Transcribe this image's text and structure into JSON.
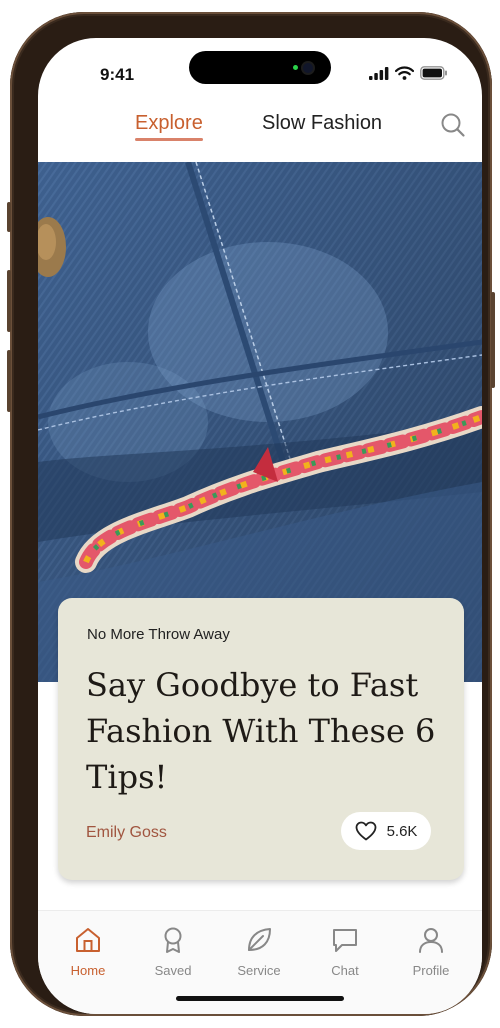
{
  "status_bar": {
    "time": "9:41"
  },
  "top_nav": {
    "tabs": [
      {
        "label": "Explore",
        "active": true
      },
      {
        "label": "Slow Fashion",
        "active": false
      }
    ]
  },
  "article": {
    "kicker": "No More Throw Away",
    "title": "Say Goodbye to Fast Fashion With These 6 Tips!",
    "author": "Emily Goss",
    "likes": "5.6K",
    "hero_image": "denim jacket with colorful embroidered hem"
  },
  "bottom_nav": {
    "items": [
      {
        "label": "Home",
        "icon": "home-icon",
        "active": true
      },
      {
        "label": "Saved",
        "icon": "ribbon-icon",
        "active": false
      },
      {
        "label": "Service",
        "icon": "leaf-icon",
        "active": false
      },
      {
        "label": "Chat",
        "icon": "chat-icon",
        "active": false
      },
      {
        "label": "Profile",
        "icon": "person-icon",
        "active": false
      }
    ]
  },
  "colors": {
    "accent": "#c8602f",
    "card": "#e7e6d8",
    "author": "#a0553f",
    "denim": "#3d5e8c"
  }
}
